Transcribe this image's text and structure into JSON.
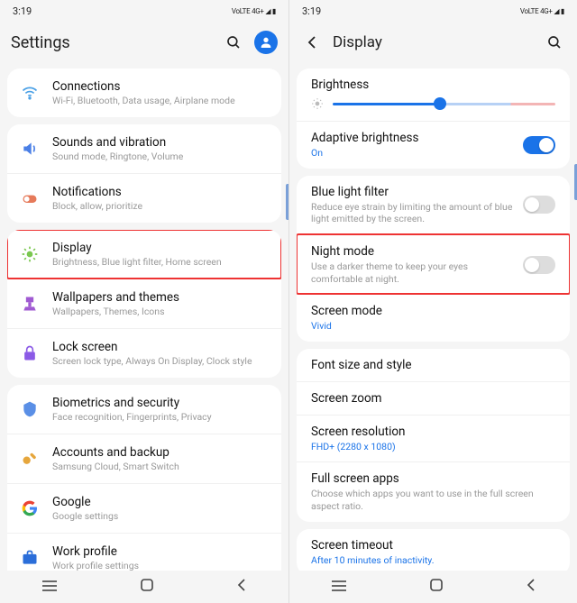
{
  "left": {
    "status_time": "3:19",
    "status_right": "VoLTE 4G+ ◢ ▮",
    "title": "Settings",
    "groups": [
      {
        "items": [
          {
            "icon": "wifi",
            "color": "#4aa0e6",
            "title": "Connections",
            "sub": "Wi-Fi, Bluetooth, Data usage, Airplane mode"
          }
        ]
      },
      {
        "items": [
          {
            "icon": "sound",
            "color": "#4a7fe6",
            "title": "Sounds and vibration",
            "sub": "Sound mode, Ringtone, Volume"
          },
          {
            "icon": "notif",
            "color": "#e67a5a",
            "title": "Notifications",
            "sub": "Block, allow, prioritize"
          }
        ]
      },
      {
        "items": [
          {
            "icon": "display",
            "color": "#7ac74f",
            "title": "Display",
            "sub": "Brightness, Blue light filter, Home screen",
            "hl": true
          },
          {
            "icon": "wall",
            "color": "#a05ad2",
            "title": "Wallpapers and themes",
            "sub": "Wallpapers, Themes, Icons"
          },
          {
            "icon": "lock",
            "color": "#8b5ae6",
            "title": "Lock screen",
            "sub": "Screen lock type, Always On Display, Clock style"
          }
        ]
      },
      {
        "items": [
          {
            "icon": "bio",
            "color": "#5a8fe6",
            "title": "Biometrics and security",
            "sub": "Face recognition, Fingerprints, Privacy"
          },
          {
            "icon": "backup",
            "color": "#e6a63c",
            "title": "Accounts and backup",
            "sub": "Samsung Cloud, Smart Switch"
          },
          {
            "icon": "google",
            "color": "#4285f4",
            "title": "Google",
            "sub": "Google settings"
          },
          {
            "icon": "work",
            "color": "#2b6ed9",
            "title": "Work profile",
            "sub": "Work profile settings"
          }
        ]
      }
    ]
  },
  "right": {
    "status_time": "3:19",
    "status_right": "VoLTE 4G+ ◢ ▮",
    "title": "Display",
    "brightness_label": "Brightness",
    "sections": [
      {
        "rows": [
          {
            "title": "Adaptive brightness",
            "sub": "On",
            "accent": true,
            "toggle": "on"
          }
        ]
      },
      {
        "rows": [
          {
            "title": "Blue light filter",
            "sub": "Reduce eye strain by limiting the amount of blue light emitted by the screen.",
            "toggle": "off"
          },
          {
            "title": "Night mode",
            "sub": "Use a darker theme to keep your eyes comfortable at night.",
            "toggle": "off",
            "hl": true
          },
          {
            "title": "Screen mode",
            "sub": "Vivid",
            "accent": true
          }
        ]
      },
      {
        "rows": [
          {
            "title": "Font size and style"
          },
          {
            "title": "Screen zoom"
          },
          {
            "title": "Screen resolution",
            "sub": "FHD+ (2280 x 1080)",
            "accent": true
          },
          {
            "title": "Full screen apps",
            "sub": "Choose which apps you want to use in the full screen aspect ratio."
          }
        ]
      },
      {
        "rows": [
          {
            "title": "Screen timeout",
            "sub": "After 10 minutes of inactivity.",
            "accent": true
          }
        ]
      }
    ]
  }
}
